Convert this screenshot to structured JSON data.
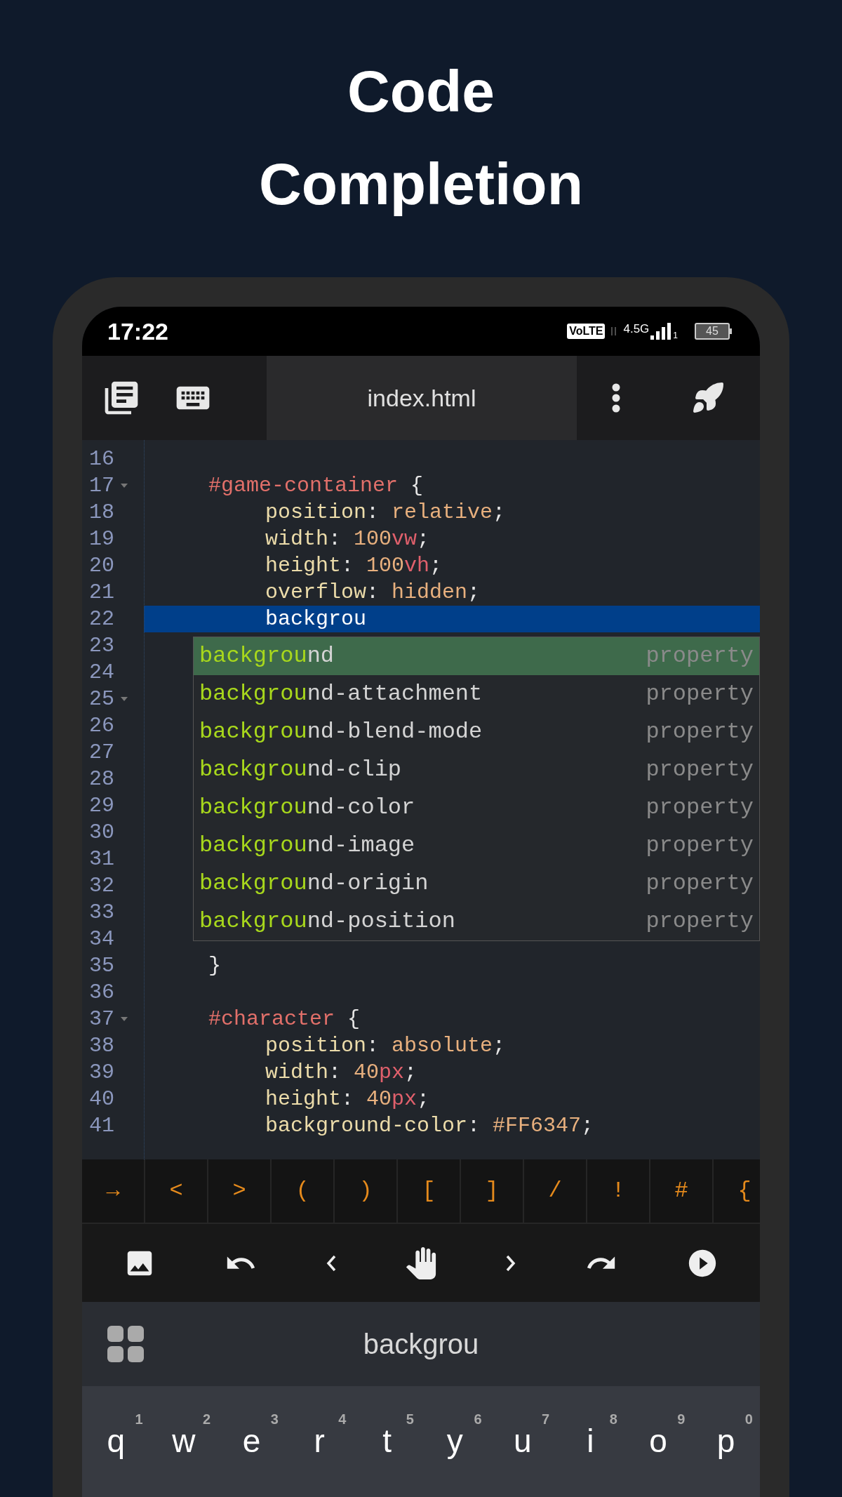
{
  "headline": [
    "Code",
    "Completion"
  ],
  "status_bar": {
    "time": "17:22",
    "volte": "VoLTE",
    "network": "4.5G",
    "sim": "1",
    "battery": "45"
  },
  "toolbar": {
    "file_tab": "index.html"
  },
  "editor": {
    "lines": [
      {
        "number": "16",
        "kind": "blank",
        "foldable": false,
        "highlighted": false
      },
      {
        "number": "17",
        "kind": "rule",
        "foldable": true,
        "highlighted": false,
        "tokens": [
          {
            "kind": "selector",
            "text": "#game-container"
          },
          {
            "kind": "punct",
            "text": " {"
          }
        ]
      },
      {
        "number": "18",
        "kind": "declaration",
        "foldable": false,
        "highlighted": false,
        "tokens": [
          {
            "kind": "property",
            "text": "position"
          },
          {
            "kind": "punct",
            "text": ": "
          },
          {
            "kind": "value",
            "text": "relative"
          },
          {
            "kind": "punct",
            "text": ";"
          }
        ]
      },
      {
        "number": "19",
        "kind": "declaration",
        "foldable": false,
        "highlighted": false,
        "tokens": [
          {
            "kind": "property",
            "text": "width"
          },
          {
            "kind": "punct",
            "text": ": "
          },
          {
            "kind": "value",
            "text": "100"
          },
          {
            "kind": "unit",
            "text": "vw"
          },
          {
            "kind": "punct",
            "text": ";"
          }
        ]
      },
      {
        "number": "20",
        "kind": "declaration",
        "foldable": false,
        "highlighted": false,
        "tokens": [
          {
            "kind": "property",
            "text": "height"
          },
          {
            "kind": "punct",
            "text": ": "
          },
          {
            "kind": "value",
            "text": "100"
          },
          {
            "kind": "unit",
            "text": "vh"
          },
          {
            "kind": "punct",
            "text": ";"
          }
        ]
      },
      {
        "number": "21",
        "kind": "declaration",
        "foldable": false,
        "highlighted": false,
        "tokens": [
          {
            "kind": "property",
            "text": "overflow"
          },
          {
            "kind": "punct",
            "text": ": "
          },
          {
            "kind": "value",
            "text": "hidden"
          },
          {
            "kind": "punct",
            "text": ";"
          }
        ]
      },
      {
        "number": "22",
        "kind": "declaration",
        "foldable": false,
        "highlighted": true,
        "tokens": [
          {
            "kind": "plain",
            "text": "backgrou"
          }
        ]
      },
      {
        "number": "23",
        "kind": "blank",
        "foldable": false,
        "highlighted": false
      },
      {
        "number": "24",
        "kind": "blank",
        "foldable": false,
        "highlighted": false
      },
      {
        "number": "25",
        "kind": "blank",
        "foldable": true,
        "highlighted": false
      },
      {
        "number": "26",
        "kind": "blank",
        "foldable": false,
        "highlighted": false
      },
      {
        "number": "27",
        "kind": "blank",
        "foldable": false,
        "highlighted": false
      },
      {
        "number": "28",
        "kind": "blank",
        "foldable": false,
        "highlighted": false
      },
      {
        "number": "29",
        "kind": "blank",
        "foldable": false,
        "highlighted": false
      },
      {
        "number": "30",
        "kind": "blank",
        "foldable": false,
        "highlighted": false
      },
      {
        "number": "31",
        "kind": "blank",
        "foldable": false,
        "highlighted": false
      },
      {
        "number": "32",
        "kind": "blank",
        "foldable": false,
        "highlighted": false
      },
      {
        "number": "33",
        "kind": "blank",
        "foldable": false,
        "highlighted": false
      },
      {
        "number": "34",
        "kind": "blank",
        "foldable": false,
        "highlighted": false
      },
      {
        "number": "35",
        "kind": "rule",
        "foldable": false,
        "highlighted": false,
        "tokens": [
          {
            "kind": "punct",
            "text": "}"
          }
        ]
      },
      {
        "number": "36",
        "kind": "blank",
        "foldable": false,
        "highlighted": false
      },
      {
        "number": "37",
        "kind": "rule",
        "foldable": true,
        "highlighted": false,
        "tokens": [
          {
            "kind": "selector",
            "text": "#character"
          },
          {
            "kind": "punct",
            "text": " {"
          }
        ]
      },
      {
        "number": "38",
        "kind": "declaration",
        "foldable": false,
        "highlighted": false,
        "tokens": [
          {
            "kind": "property",
            "text": "position"
          },
          {
            "kind": "punct",
            "text": ": "
          },
          {
            "kind": "value",
            "text": "absolute"
          },
          {
            "kind": "punct",
            "text": ";"
          }
        ]
      },
      {
        "number": "39",
        "kind": "declaration",
        "foldable": false,
        "highlighted": false,
        "tokens": [
          {
            "kind": "property",
            "text": "width"
          },
          {
            "kind": "punct",
            "text": ": "
          },
          {
            "kind": "value",
            "text": "40"
          },
          {
            "kind": "unit",
            "text": "px"
          },
          {
            "kind": "punct",
            "text": ";"
          }
        ]
      },
      {
        "number": "40",
        "kind": "declaration",
        "foldable": false,
        "highlighted": false,
        "tokens": [
          {
            "kind": "property",
            "text": "height"
          },
          {
            "kind": "punct",
            "text": ": "
          },
          {
            "kind": "value",
            "text": "40"
          },
          {
            "kind": "unit",
            "text": "px"
          },
          {
            "kind": "punct",
            "text": ";"
          }
        ]
      },
      {
        "number": "41",
        "kind": "declaration",
        "foldable": false,
        "highlighted": false,
        "tokens": [
          {
            "kind": "property",
            "text": "background-color"
          },
          {
            "kind": "punct",
            "text": ": "
          },
          {
            "kind": "value",
            "text": "#FF6347"
          },
          {
            "kind": "punct",
            "text": ";"
          }
        ]
      }
    ]
  },
  "completion": {
    "items": [
      {
        "match": "backgrou",
        "rest": "nd",
        "type": "property",
        "selected": true
      },
      {
        "match": "backgrou",
        "rest": "nd-attachment",
        "type": "property",
        "selected": false
      },
      {
        "match": "backgrou",
        "rest": "nd-blend-mode",
        "type": "property",
        "selected": false
      },
      {
        "match": "backgrou",
        "rest": "nd-clip",
        "type": "property",
        "selected": false
      },
      {
        "match": "backgrou",
        "rest": "nd-color",
        "type": "property",
        "selected": false
      },
      {
        "match": "backgrou",
        "rest": "nd-image",
        "type": "property",
        "selected": false
      },
      {
        "match": "backgrou",
        "rest": "nd-origin",
        "type": "property",
        "selected": false
      },
      {
        "match": "backgrou",
        "rest": "nd-position",
        "type": "property",
        "selected": false
      }
    ]
  },
  "symbols": [
    "→",
    "<",
    ">",
    "(",
    ")",
    "[",
    "]",
    "/",
    "!",
    "#",
    "{"
  ],
  "keyboard": {
    "suggestion": "backgrou",
    "keys": [
      {
        "letter": "q",
        "digit": "1"
      },
      {
        "letter": "w",
        "digit": "2"
      },
      {
        "letter": "e",
        "digit": "3"
      },
      {
        "letter": "r",
        "digit": "4"
      },
      {
        "letter": "t",
        "digit": "5"
      },
      {
        "letter": "y",
        "digit": "6"
      },
      {
        "letter": "u",
        "digit": "7"
      },
      {
        "letter": "i",
        "digit": "8"
      },
      {
        "letter": "o",
        "digit": "9"
      },
      {
        "letter": "p",
        "digit": "0"
      }
    ]
  }
}
